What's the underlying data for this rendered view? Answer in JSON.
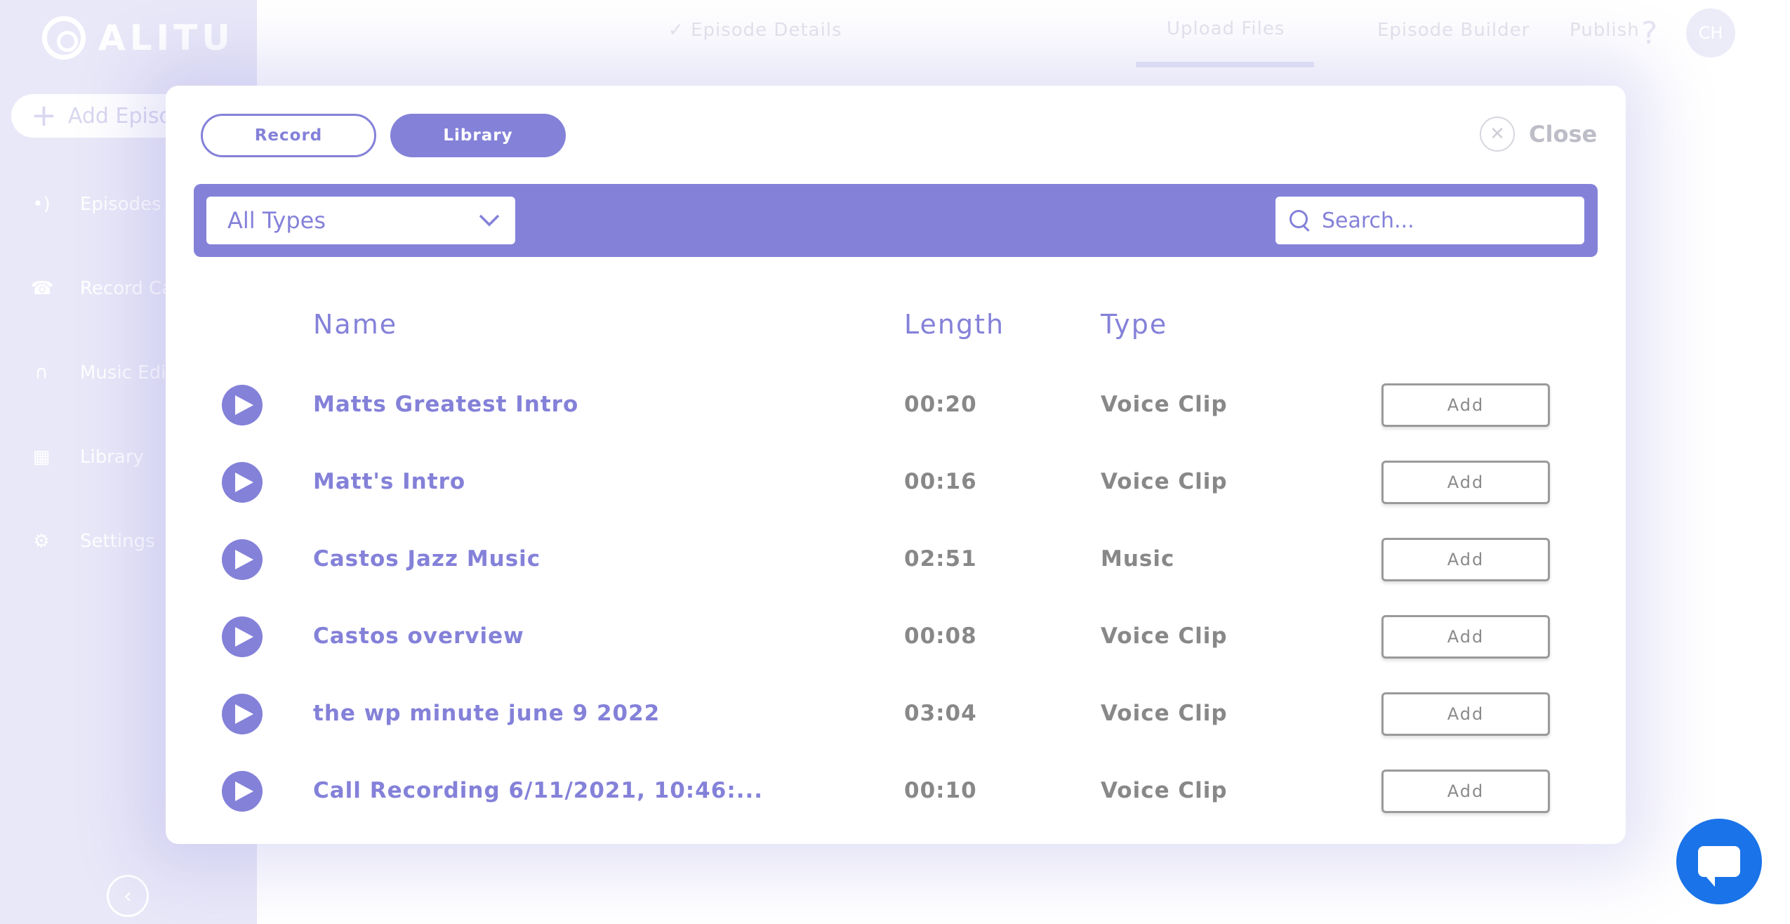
{
  "app": {
    "logo_text": "ALITU"
  },
  "sidebar": {
    "add_episode_label": "Add Episode",
    "items": [
      {
        "label": "Episodes"
      },
      {
        "label": "Record Call"
      },
      {
        "label": "Music Editor"
      },
      {
        "label": "Library"
      },
      {
        "label": "Settings"
      }
    ]
  },
  "topnav": {
    "steps": [
      {
        "label": "Episode Details"
      },
      {
        "label": "Upload Files"
      },
      {
        "label": "Episode Builder"
      },
      {
        "label": "Publish"
      }
    ],
    "help": "?",
    "avatar_initials": "CH"
  },
  "modal": {
    "tabs": {
      "record": "Record",
      "library": "Library"
    },
    "close_label": "Close",
    "filter": {
      "selected": "All Types"
    },
    "search": {
      "placeholder": "Search..."
    },
    "columns": {
      "name": "Name",
      "length": "Length",
      "type": "Type"
    },
    "add_label": "Add",
    "rows": [
      {
        "name": "Matts Greatest Intro",
        "length": "00:20",
        "type": "Voice Clip"
      },
      {
        "name": "Matt's Intro",
        "length": "00:16",
        "type": "Voice Clip"
      },
      {
        "name": "Castos Jazz Music",
        "length": "02:51",
        "type": "Music"
      },
      {
        "name": "Castos overview",
        "length": "00:08",
        "type": "Voice Clip"
      },
      {
        "name": "the wp minute june 9 2022",
        "length": "03:04",
        "type": "Voice Clip"
      },
      {
        "name": "Call Recording 6/11/2021, 10:46:...",
        "length": "00:10",
        "type": "Voice Clip"
      }
    ]
  },
  "colors": {
    "accent": "#8481d9",
    "sidebar_bg": "#e9e8f8",
    "chat": "#1a73e8"
  }
}
